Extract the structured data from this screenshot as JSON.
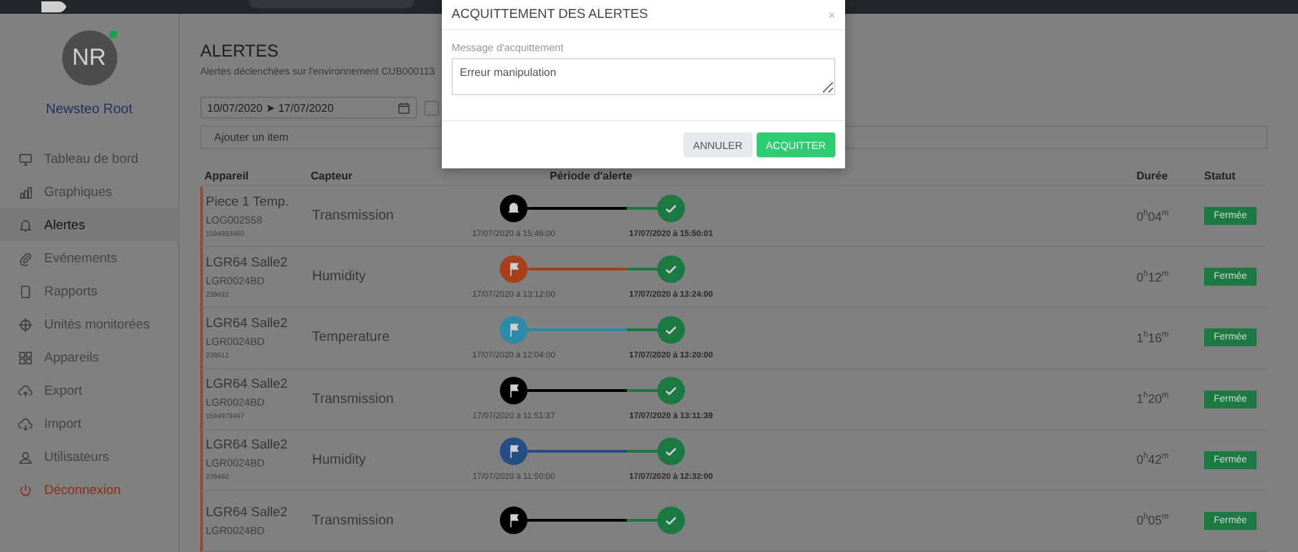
{
  "user": {
    "initials": "NR",
    "name": "Newsteo Root",
    "online": true
  },
  "sidebar": {
    "items": [
      {
        "label": "Tableau de bord",
        "selected": false,
        "kind": "link"
      },
      {
        "label": "Graphiques",
        "selected": false,
        "kind": "link"
      },
      {
        "label": "Alertes",
        "selected": true,
        "kind": "link"
      },
      {
        "label": "Evénements",
        "selected": false,
        "kind": "link"
      },
      {
        "label": "Rapports",
        "selected": false,
        "kind": "link"
      },
      {
        "label": "Unités monitorées",
        "selected": false,
        "kind": "link"
      },
      {
        "label": "Appareils",
        "selected": false,
        "kind": "link"
      },
      {
        "label": "Export",
        "selected": false,
        "kind": "link"
      },
      {
        "label": "Import",
        "selected": false,
        "kind": "link"
      },
      {
        "label": "Utilisateurs",
        "selected": false,
        "kind": "link"
      },
      {
        "label": "Déconnexion",
        "selected": false,
        "kind": "logout"
      }
    ]
  },
  "page": {
    "title": "ALERTES",
    "subtitle": "Alertes déclenchées sur l'environnement CUB000113"
  },
  "filters": {
    "date_range": "10/07/2020 ➤ 17/07/2020",
    "checkbox_checked": false,
    "add_item_placeholder": "Ajouter un item"
  },
  "table": {
    "columns": [
      "Appareil",
      "Capteur",
      "Période d'alerte",
      "Durée",
      "Statut"
    ],
    "rows": [
      {
        "device": "Piece 1 Temp.",
        "device_id": "LOG002558",
        "serial": "1594993560",
        "sensor": "Transmission",
        "kind": "bell",
        "color": "#000000",
        "start": "17/07/2020 à 15:46:00",
        "end": "17/07/2020 à 15:50:01",
        "duration": "0$^{h}$04$^{m}$",
        "status": "Fermée"
      },
      {
        "device": "LGR64 Salle2",
        "device_id": "LGR0024BD",
        "serial": "239632",
        "sensor": "Humidity",
        "kind": "flag",
        "color": "#a8401c",
        "start": "17/07/2020 à 13:12:00",
        "end": "17/07/2020 à 13:24:00",
        "duration": "0$^{h}$12$^{m}$",
        "status": "Fermée"
      },
      {
        "device": "LGR64 Salle2",
        "device_id": "LGR0024BD",
        "serial": "239512",
        "sensor": "Temperature",
        "kind": "flag",
        "color": "#2a8aa8",
        "start": "17/07/2020 à 12:04:00",
        "end": "17/07/2020 à 13:20:00",
        "duration": "1$^{h}$16$^{m}$",
        "status": "Fermée"
      },
      {
        "device": "LGR64 Salle2",
        "device_id": "LGR0024BD",
        "serial": "1594979497",
        "sensor": "Transmission",
        "kind": "flag",
        "color": "#000000",
        "start": "17/07/2020 à 11:51:37",
        "end": "17/07/2020 à 13:11:39",
        "duration": "1$^{h}$20$^{m}$",
        "status": "Fermée"
      },
      {
        "device": "LGR64 Salle2",
        "device_id": "LGR0024BD",
        "serial": "239492",
        "sensor": "Humidity",
        "kind": "flag",
        "color": "#234f86",
        "start": "17/07/2020 à 11:50:00",
        "end": "17/07/2020 à 12:32:00",
        "duration": "0$^{h}$42$^{m}$",
        "status": "Fermée"
      },
      {
        "device": "LGR64 Salle2",
        "device_id": "LGR0024BD",
        "sensor": "Transmission",
        "kind": "flag",
        "color": "#000000",
        "duration": "0$^{h}$05$^{m}$",
        "status": "Fermée"
      }
    ]
  },
  "modal": {
    "title": "ACQUITTEMENT DES ALERTES",
    "close": "×",
    "label": "Message d'acquittement",
    "message": "Erreur manipulation",
    "buttons": [
      {
        "label": "ANNULER",
        "kind": "secondary"
      },
      {
        "label": "ACQUITTER",
        "kind": "primary"
      }
    ]
  }
}
